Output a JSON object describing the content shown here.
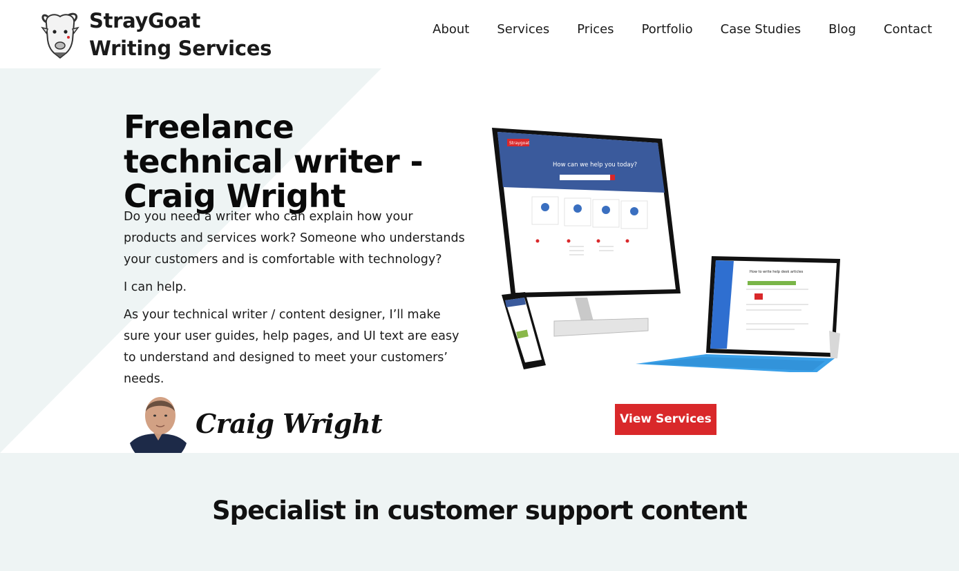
{
  "brand": {
    "name_line1": "StrayGoat",
    "name_line2": "Writing Services"
  },
  "nav": {
    "items": [
      "About",
      "Services",
      "Prices",
      "Portfolio",
      "Case Studies",
      "Blog",
      "Contact"
    ]
  },
  "hero": {
    "title": "Freelance technical writer - Craig Wright",
    "paragraphs": [
      "Do you need a writer who can explain how your products and services work? Someone who understands your customers and is comfortable with technology?",
      "I can help.",
      "As your technical writer / content designer, I’ll make sure your user guides, help pages, and UI text are easy to understand and designed to meet your customers’ needs."
    ],
    "signature": "Craig Wright",
    "cta_label": "View Services"
  },
  "mockup": {
    "monitor_logo": "Straygoat",
    "monitor_heading": "How can we help you today?",
    "tablet_heading": "How to write help desk articles"
  },
  "section": {
    "title": "Specialist in customer support content"
  },
  "colors": {
    "accent": "#d9282a",
    "tint": "#eef4f4",
    "monitor_blue": "#3a5a9c",
    "tablet_blue": "#2f6fd0",
    "keyboard_blue": "#3aa0e8"
  }
}
